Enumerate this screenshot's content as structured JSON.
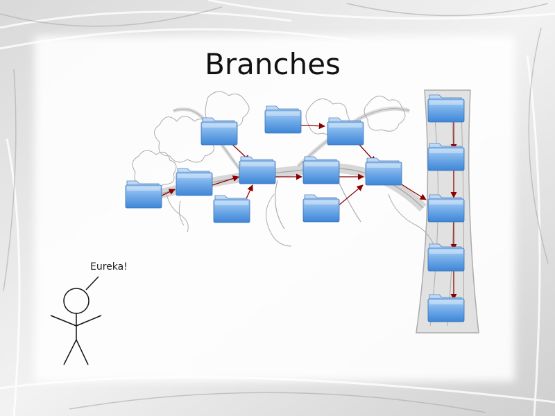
{
  "slide": {
    "title": "Branches"
  },
  "figure": {
    "speech": "Eureka!"
  },
  "colors": {
    "arrow": "#8b0000",
    "folder_top": "#a9cff5",
    "folder_bottom": "#3f86d6",
    "ink": "#111111"
  },
  "graph": {
    "folders": [
      "A",
      "B",
      "C",
      "D",
      "E",
      "F",
      "G",
      "H",
      "I",
      "J",
      "K",
      "L",
      "M",
      "N",
      "O"
    ],
    "arrows": [
      [
        "A",
        "B"
      ],
      [
        "B",
        "E"
      ],
      [
        "C",
        "E"
      ],
      [
        "D",
        "E"
      ],
      [
        "E",
        "F"
      ],
      [
        "F",
        "J"
      ],
      [
        "G",
        "J"
      ],
      [
        "H",
        "I"
      ],
      [
        "I",
        "J"
      ],
      [
        "J",
        "M"
      ],
      [
        "K",
        "L"
      ],
      [
        "L",
        "M"
      ],
      [
        "M",
        "N"
      ],
      [
        "N",
        "O"
      ]
    ]
  }
}
